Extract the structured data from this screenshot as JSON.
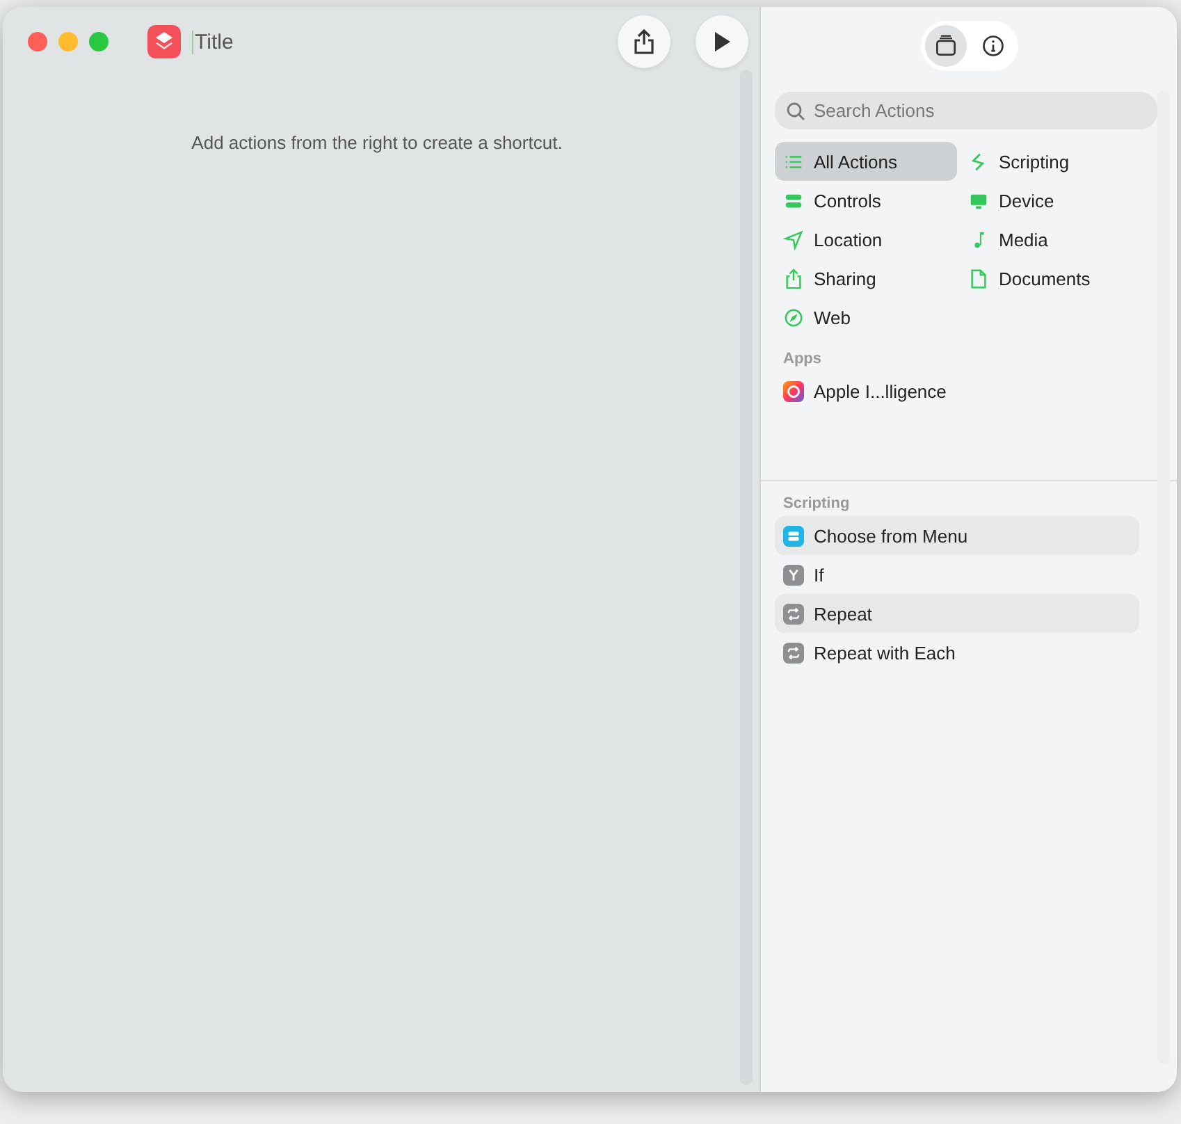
{
  "window": {
    "title": "Title"
  },
  "editor": {
    "hint": "Add actions from the right to create a shortcut."
  },
  "toolbar": {
    "tabs": [
      {
        "selected": true
      },
      {
        "selected": false
      }
    ]
  },
  "search": {
    "placeholder": "Search Actions"
  },
  "categories": [
    {
      "label": "All Actions",
      "selected": true
    },
    {
      "label": "Scripting",
      "selected": false
    },
    {
      "label": "Controls",
      "selected": false
    },
    {
      "label": "Device",
      "selected": false
    },
    {
      "label": "Location",
      "selected": false
    },
    {
      "label": "Media",
      "selected": false
    },
    {
      "label": "Sharing",
      "selected": false
    },
    {
      "label": "Documents",
      "selected": false
    },
    {
      "label": "Web",
      "selected": false
    }
  ],
  "apps": {
    "heading": "Apps",
    "items": [
      {
        "label": "Apple I...lligence"
      }
    ]
  },
  "actions": {
    "heading": "Scripting",
    "items": [
      {
        "label": "Choose from Menu",
        "color": "#1fb5e6"
      },
      {
        "label": "If",
        "color": "#8e8e93"
      },
      {
        "label": "Repeat",
        "color": "#8e8e93"
      },
      {
        "label": "Repeat with Each",
        "color": "#8e8e93"
      }
    ]
  }
}
